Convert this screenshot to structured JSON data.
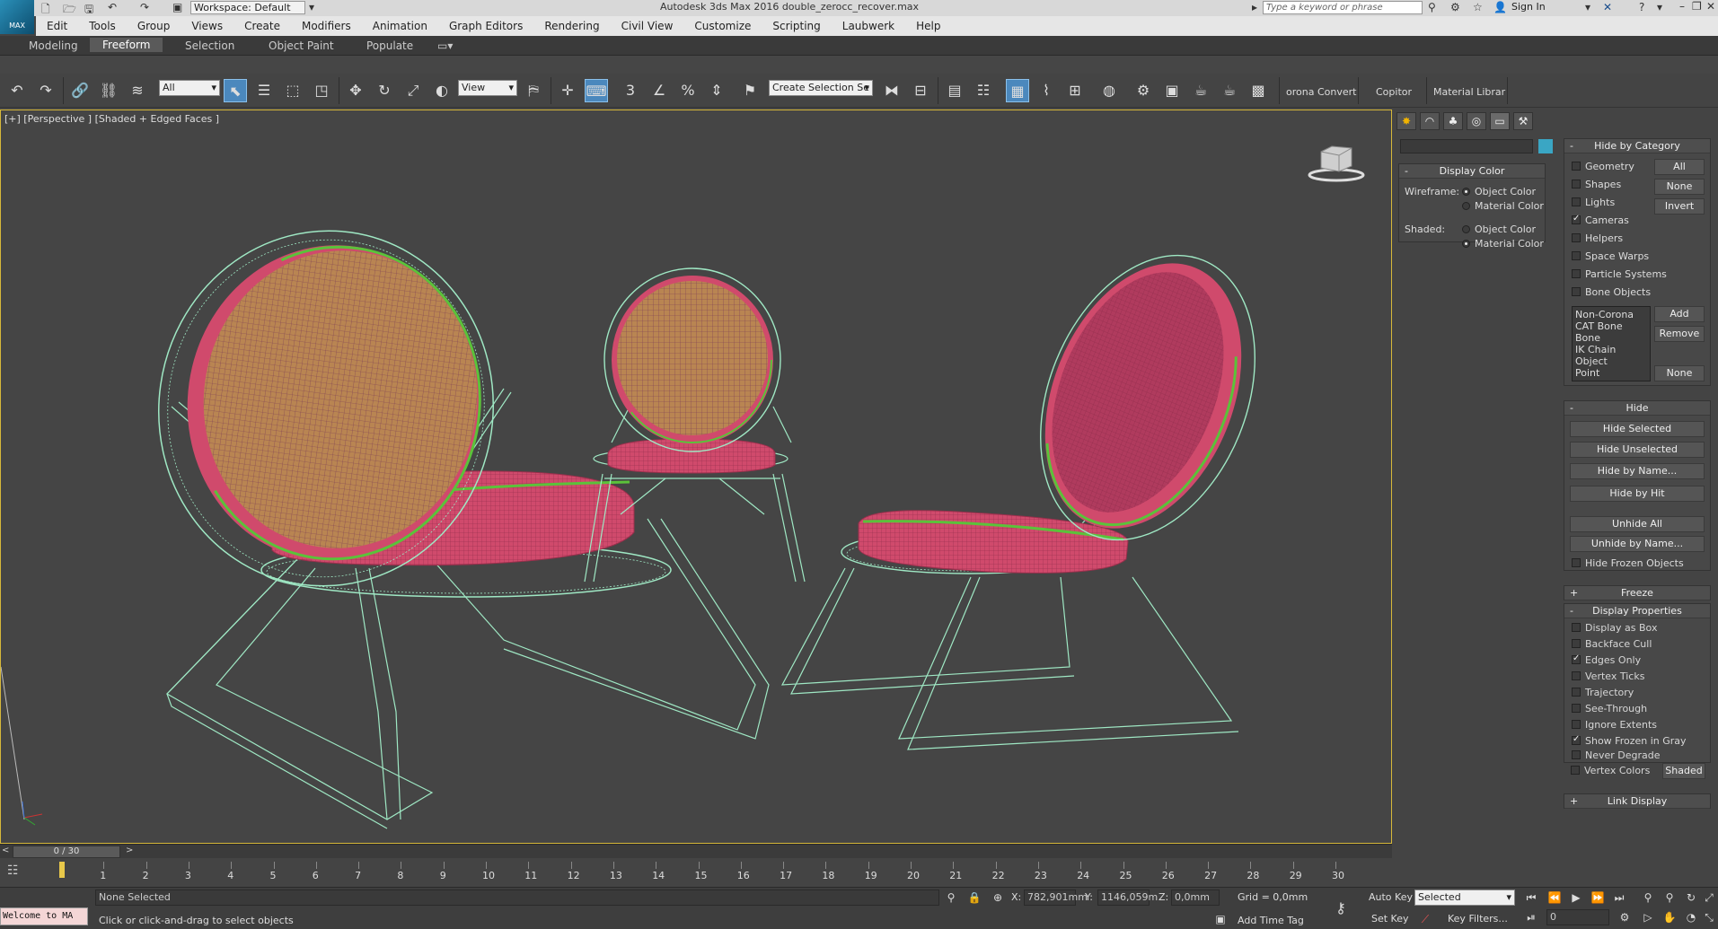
{
  "titlebar": {
    "logo_label": "MAX",
    "workspace": "Workspace: Default",
    "title": "Autodesk 3ds Max 2016     double_zerocc_recover.max",
    "search_placeholder": "Type a keyword or phrase",
    "signin": "Sign In"
  },
  "menu": [
    "Edit",
    "Tools",
    "Group",
    "Views",
    "Create",
    "Modifiers",
    "Animation",
    "Graph Editors",
    "Rendering",
    "Civil View",
    "Customize",
    "Scripting",
    "Laubwerk",
    "Help"
  ],
  "ribbon_tabs": [
    "Modeling",
    "Freeform",
    "Selection",
    "Object Paint",
    "Populate"
  ],
  "ribbon_active": "Freeform",
  "toolbar": {
    "selection_filter": "All",
    "ref_coord": "View",
    "snap_label": "3",
    "named_selection_placeholder": "Create Selection Se",
    "corona_convert": "orona Convert",
    "copitor": "Copitor",
    "material_library": "Material Librar"
  },
  "viewport": {
    "label": "[+] [Perspective ] [Shaded + Edged Faces ]"
  },
  "command_panel": {
    "display_color": {
      "title": "Display Color",
      "wireframe_label": "Wireframe:",
      "shaded_label": "Shaded:",
      "object_color": "Object Color",
      "material_color": "Material Color",
      "wireframe_selected": "Object Color",
      "shaded_selected": "Material Color"
    },
    "hide_by_category": {
      "title": "Hide by Category",
      "items": [
        {
          "label": "Geometry",
          "checked": false
        },
        {
          "label": "Shapes",
          "checked": false
        },
        {
          "label": "Lights",
          "checked": false
        },
        {
          "label": "Cameras",
          "checked": true
        },
        {
          "label": "Helpers",
          "checked": false
        },
        {
          "label": "Space Warps",
          "checked": false
        },
        {
          "label": "Particle Systems",
          "checked": false
        },
        {
          "label": "Bone Objects",
          "checked": false
        }
      ],
      "btn_all": "All",
      "btn_none": "None",
      "btn_invert": "Invert",
      "list": [
        "Non-Corona",
        "CAT Bone",
        "Bone",
        "IK Chain Object",
        "Point"
      ],
      "btn_add": "Add",
      "btn_remove": "Remove",
      "btn_none2": "None"
    },
    "hide": {
      "title": "Hide",
      "buttons": [
        "Hide Selected",
        "Hide Unselected",
        "Hide by Name...",
        "Hide by Hit",
        "Unhide All",
        "Unhide by Name..."
      ],
      "hide_frozen": "Hide Frozen Objects"
    },
    "freeze": {
      "title": "Freeze"
    },
    "display_properties": {
      "title": "Display Properties",
      "items": [
        {
          "label": "Display as Box",
          "checked": false
        },
        {
          "label": "Backface Cull",
          "checked": false
        },
        {
          "label": "Edges Only",
          "checked": true
        },
        {
          "label": "Vertex Ticks",
          "checked": false
        },
        {
          "label": "Trajectory",
          "checked": false
        },
        {
          "label": "See-Through",
          "checked": false
        },
        {
          "label": "Ignore Extents",
          "checked": false
        },
        {
          "label": "Show Frozen in Gray",
          "checked": true
        },
        {
          "label": "Never Degrade",
          "checked": false
        },
        {
          "label": "Vertex Colors",
          "checked": false
        }
      ],
      "shaded_btn": "Shaded"
    },
    "link_display": {
      "title": "Link Display"
    }
  },
  "timeline": {
    "slider": "0 / 30",
    "ticks": [
      "1",
      "2",
      "3",
      "4",
      "5",
      "6",
      "7",
      "8",
      "9",
      "10",
      "11",
      "12",
      "13",
      "14",
      "15",
      "16",
      "17",
      "18",
      "19",
      "20",
      "21",
      "22",
      "23",
      "24",
      "25",
      "26",
      "27",
      "28",
      "29",
      "30"
    ]
  },
  "status": {
    "maxscript": "Welcome to MA",
    "selection": "None Selected",
    "prompt": "Click or click-and-drag to select objects",
    "x_label": "X:",
    "x_value": "782,901mm",
    "y_label": "Y:",
    "y_value": "1146,059m",
    "z_label": "Z:",
    "z_value": "0,0mm",
    "grid": "Grid = 0,0mm",
    "add_time_tag": "Add Time Tag",
    "auto_key": "Auto Key",
    "set_key": "Set Key",
    "key_mode": "Selected",
    "key_filters": "Key Filters...",
    "frame": "0"
  },
  "colors": {
    "viewport_bg": "#454545",
    "wire": "#9fe8c4",
    "cushion": "#d9456e",
    "cushion_inner": "#b8854e",
    "trim": "#5bc23a",
    "active_border": "#d6b83a"
  }
}
